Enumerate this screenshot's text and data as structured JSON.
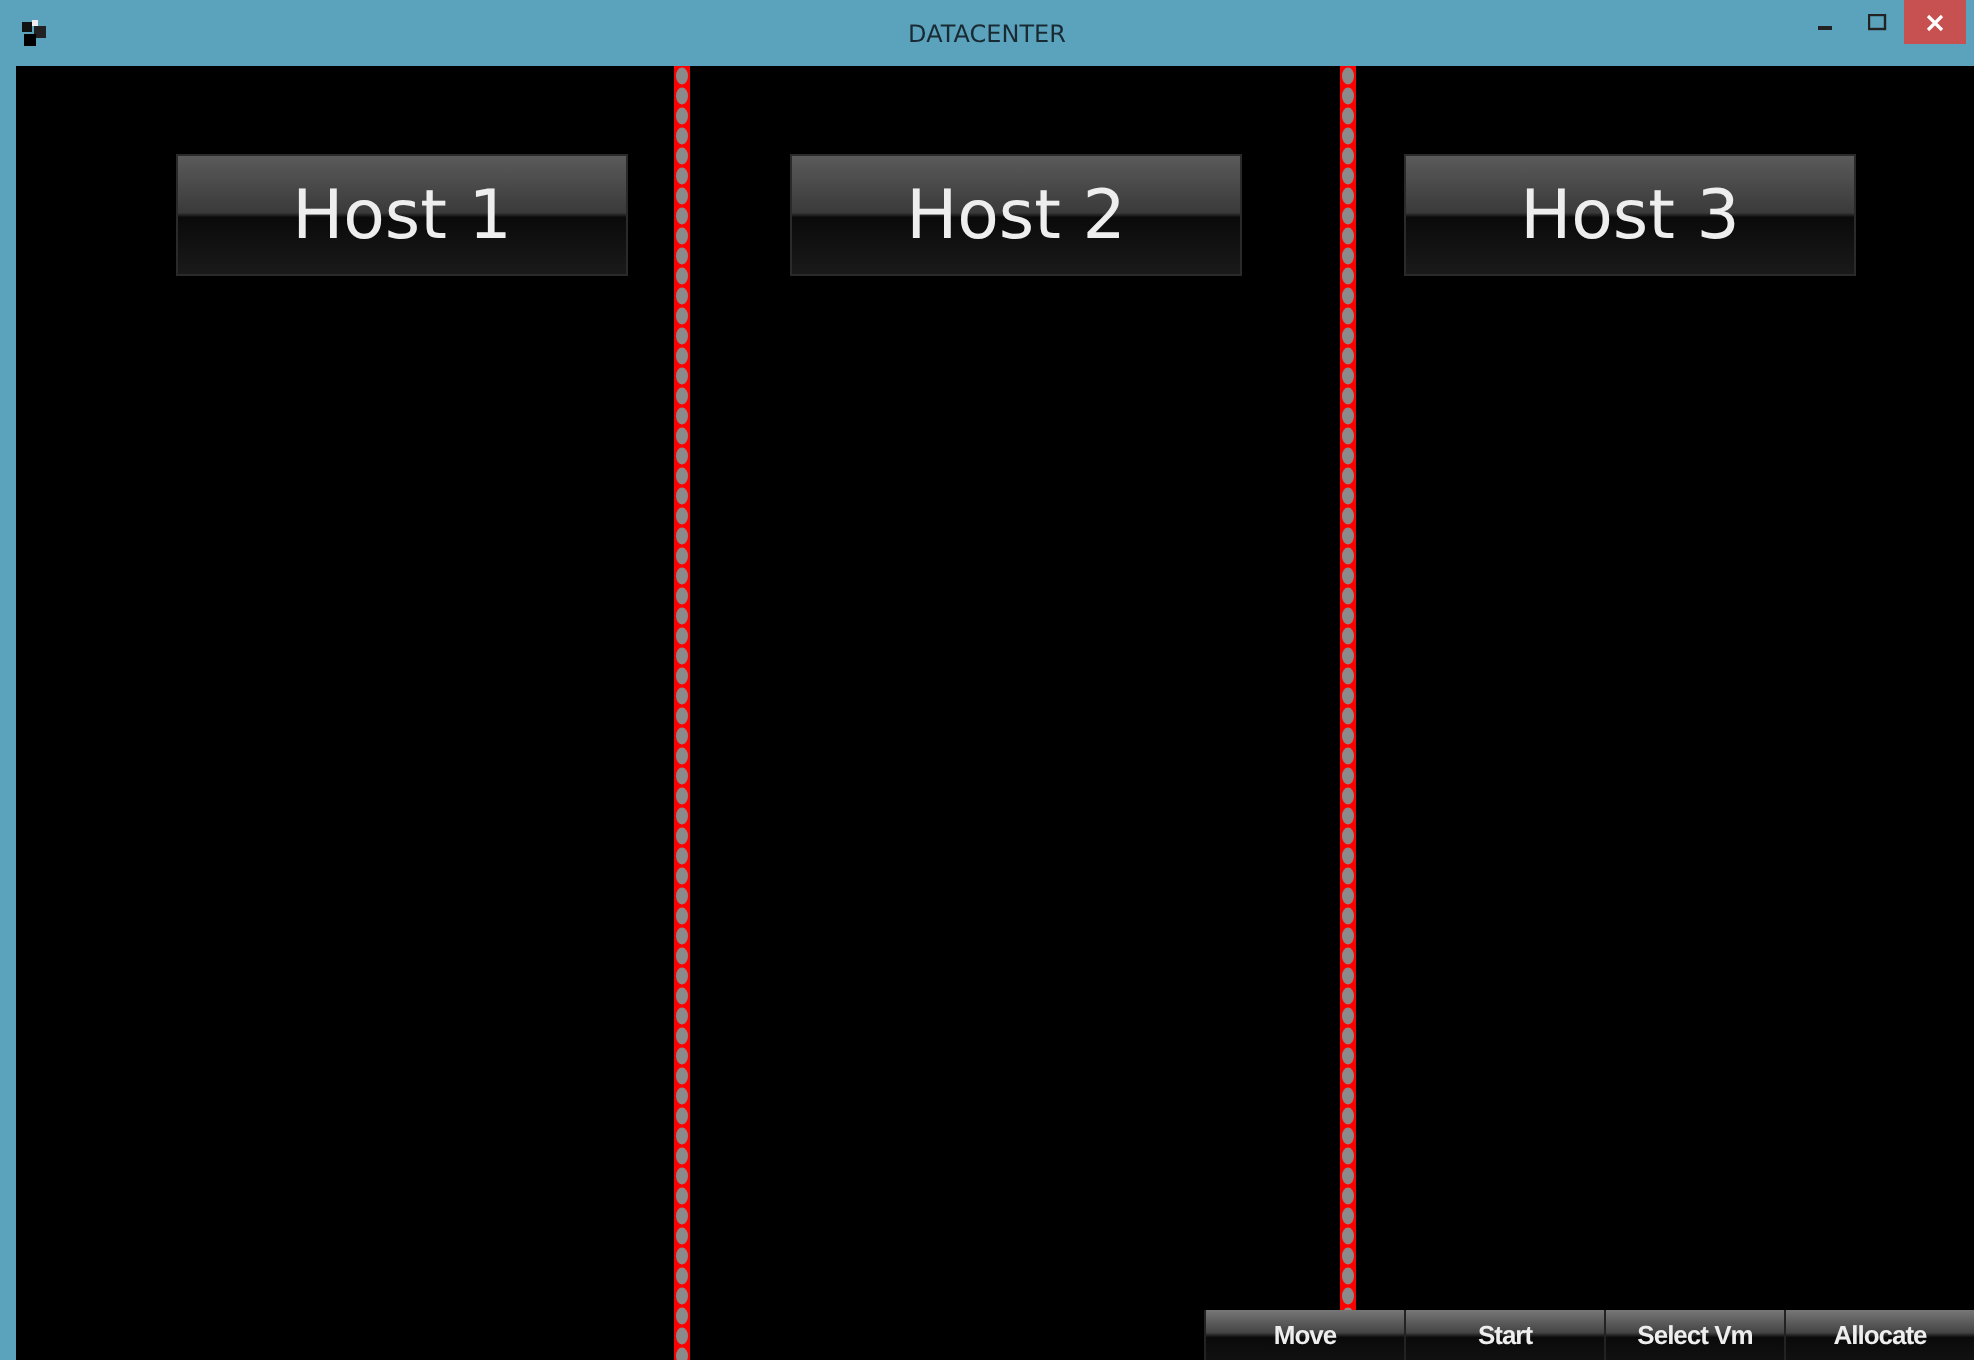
{
  "window": {
    "title": "DATACENTER"
  },
  "hosts": [
    {
      "label": "Host 1"
    },
    {
      "label": "Host 2"
    },
    {
      "label": "Host 3"
    }
  ],
  "actions": [
    "Move",
    "Start",
    "Select Vm",
    "Allocate"
  ]
}
